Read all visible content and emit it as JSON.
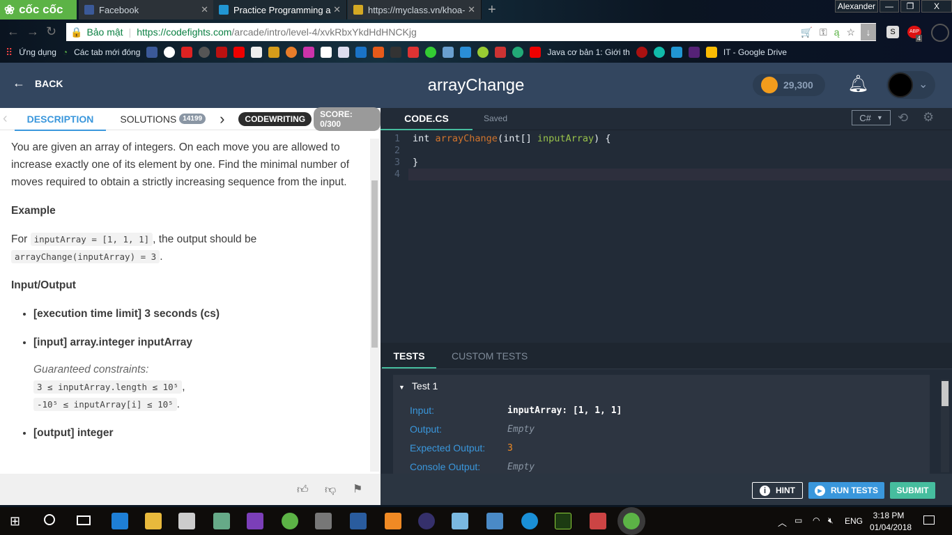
{
  "browser": {
    "brand": "cốc cốc",
    "tabs": [
      {
        "title": "Facebook"
      },
      {
        "title": "Practice Programming and"
      },
      {
        "title": "https://myclass.vn/khoa-h"
      }
    ],
    "profile": "Alexander",
    "window_controls": [
      "—",
      "❐",
      "X"
    ],
    "secure_label": "Bảo mật",
    "url_host": "https://codefights.com",
    "url_path": "/arcade/intro/level-4/xvkRbxYkdHdHNCKjg",
    "abp_count": "4",
    "bookmarks": {
      "apps": "Ứng dụng",
      "closed_tabs": "Các tab mới đóng",
      "java": "Java cơ bản 1: Giới th",
      "drive": "IT - Google Drive"
    }
  },
  "header": {
    "back": "BACK",
    "title": "arrayChange",
    "coins": "29,300"
  },
  "left": {
    "tabs": {
      "description": "DESCRIPTION",
      "solutions": "SOLUTIONS",
      "solutions_count": "14199"
    },
    "badges": {
      "type": "CODEWRITING",
      "score": "SCORE: 0/300"
    },
    "intro": "You are given an array of integers. On each move you are allowed to increase exactly one of its element by one. Find the minimal number of moves required to obtain a strictly increasing sequence from the input.",
    "example_heading": "Example",
    "example_for": "For",
    "example_code1": "inputArray = [1, 1, 1]",
    "example_mid": ", the output should be",
    "example_code2": "arrayChange(inputArray) = 3",
    "io_heading": "Input/Output",
    "io": [
      "[execution time limit] 3 seconds (cs)",
      "[input] array.integer inputArray",
      "[output] integer"
    ],
    "constraints_label": "Guaranteed constraints:",
    "constraint1": "3 ≤ inputArray.length ≤ 10⁵",
    "constraint2": "-10⁵ ≤ inputArray[i] ≤ 10⁵"
  },
  "editor": {
    "file": "CODE.CS",
    "status": "Saved",
    "language": "C#",
    "lines": [
      "1",
      "2",
      "3",
      "4"
    ],
    "code": {
      "kw": "int",
      "fn": "arrayChange",
      "open": "(int[] ",
      "param": "inputArray",
      "close": ") {",
      "end": "}"
    }
  },
  "tests": {
    "tabs": [
      "TESTS",
      "CUSTOM TESTS"
    ],
    "name": "Test 1",
    "rows": [
      {
        "label": "Input:",
        "value": "inputArray: [1, 1, 1]"
      },
      {
        "label": "Output:",
        "value": "Empty"
      },
      {
        "label": "Expected Output:",
        "value": "3"
      },
      {
        "label": "Console Output:",
        "value": "Empty"
      }
    ]
  },
  "actions": {
    "hint": "HINT",
    "run": "RUN TESTS",
    "submit": "SUBMIT"
  },
  "taskbar": {
    "time": "3:18 PM",
    "date": "01/04/2018",
    "lang": "ENG"
  },
  "colors": {
    "accent": "#3a97dc",
    "submit": "#46bd9e",
    "header": "#33465f",
    "expected": "#f08a24"
  }
}
